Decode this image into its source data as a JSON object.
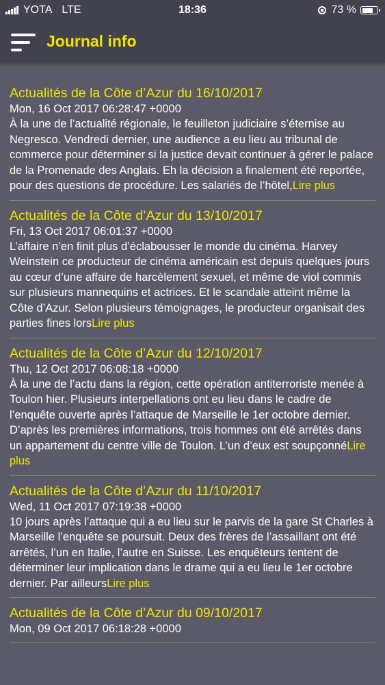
{
  "status_bar": {
    "carrier": "YOTA",
    "network": "LTE",
    "time": "18:36",
    "battery": "73 %",
    "battery_level": 0.73
  },
  "app_bar": {
    "title": "Journal info",
    "menu_icon": "menu-icon"
  },
  "colors": {
    "accent": "#f2e500",
    "background": "#5a5a68",
    "bar": "#42424e"
  },
  "articles": [
    {
      "title": "Actualités de la Côte d’Azur du 16/10/2017",
      "date": "Mon, 16 Oct 2017 06:28:47 +0000",
      "body": "À la une de l’actualité régionale, le feuilleton judiciaire s’éternise au Negresco. Vendredi dernier, une audience a eu lieu au tribunal de commerce pour déterminer si la justice devait continuer à gérer le palace de la Promenade des Anglais. Eh la décision a finalement été reportée, pour des questions de procédure. Les salariés de l’hôtel,",
      "read_more": "Lire plus"
    },
    {
      "title": "Actualités de la Côte d’Azur du 13/10/2017",
      "date": "Fri, 13 Oct 2017 06:01:37 +0000",
      "body": "L’affaire n’en finit plus d’éclabousser le monde du cinéma. Harvey Weinstein ce producteur de cinéma américain est depuis quelques jours au cœur d’une affaire de harcèlement sexuel, et même de viol commis sur plusieurs mannequins et actrices. Et le scandale atteint même la Côte d’Azur. Selon plusieurs témoignages, le producteur organisait des parties fines lors",
      "read_more": "Lire plus"
    },
    {
      "title": "Actualités de la Côte d’Azur du 12/10/2017",
      "date": "Thu, 12 Oct 2017 06:08:18 +0000",
      "body": "À la une de l’actu dans la région, cette opération antiterroriste menée à Toulon hier. Plusieurs interpellations ont eu lieu dans le cadre de l’enquête ouverte après l’attaque de Marseille le 1er octobre dernier. D’après les premières informations, trois hommes ont été arrêtés dans un appartement du centre ville de Toulon. L’un d’eux est soupçonné",
      "read_more": "Lire plus"
    },
    {
      "title": "Actualités de la Côte d’Azur du 11/10/2017",
      "date": "Wed, 11 Oct 2017 07:19:38 +0000",
      "body": "10 jours après l’attaque qui a eu lieu sur le parvis de la gare St Charles à Marseille l’enquête se poursuit. Deux des frères de l’assaillant ont été arrêtés, l’un en Italie, l’autre en Suisse. Les enquêteurs tentent de déterminer leur implication dans le drame qui a eu lieu le 1er octobre dernier. Par ailleurs",
      "read_more": "Lire plus"
    },
    {
      "title": "Actualités de la Côte d’Azur du 09/10/2017",
      "date": "Mon, 09 Oct 2017 06:18:28 +0000",
      "body": "",
      "read_more": ""
    }
  ]
}
